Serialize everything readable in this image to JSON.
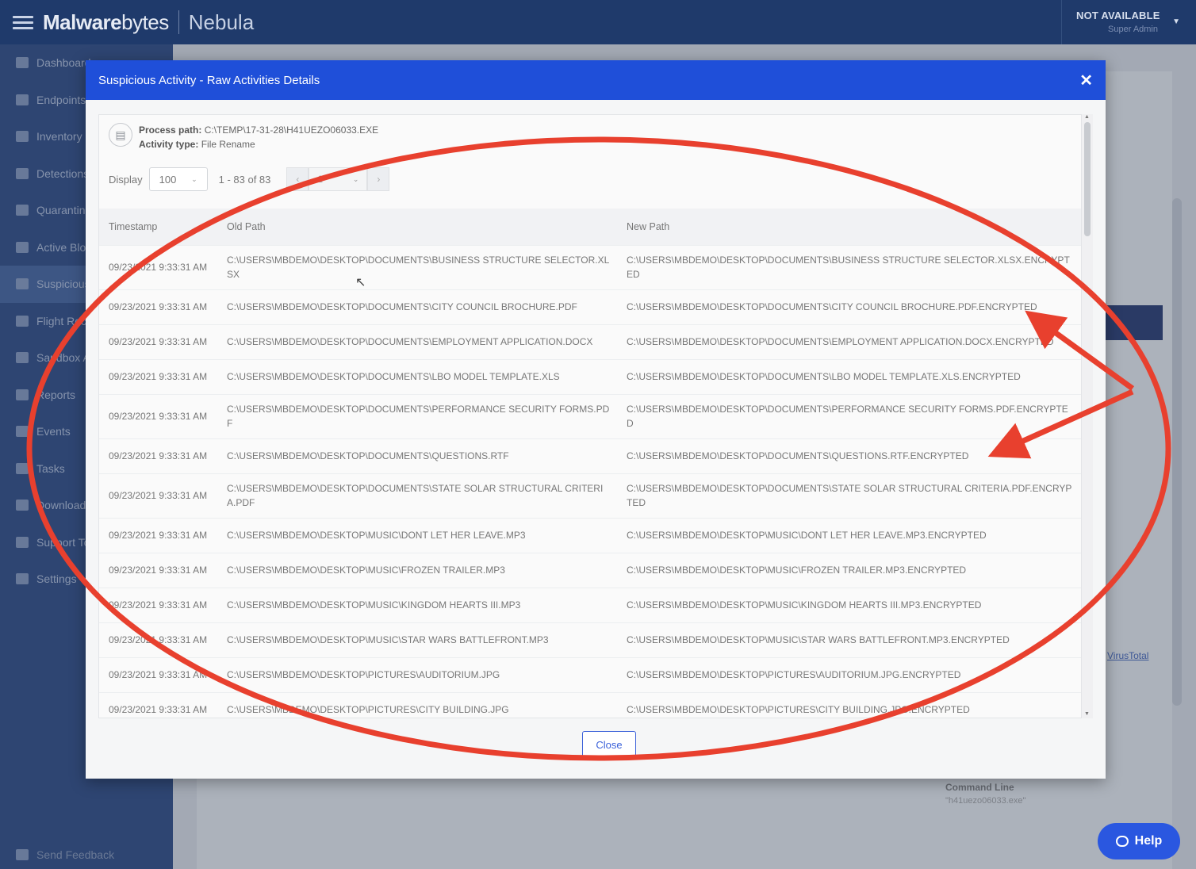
{
  "header": {
    "logo_bold": "Malware",
    "logo_light": "bytes",
    "product": "Nebula",
    "account_name": "NOT AVAILABLE",
    "account_role": "Super Admin"
  },
  "sidebar": {
    "items": [
      {
        "label": "Dashboard",
        "icon": "chart-icon"
      },
      {
        "label": "Endpoints",
        "icon": "monitor-icon"
      },
      {
        "label": "Inventory",
        "icon": "tag-icon"
      },
      {
        "label": "Detections",
        "icon": "bug-icon"
      },
      {
        "label": "Quarantine",
        "icon": "shield-icon"
      },
      {
        "label": "Active Blocks",
        "icon": "arrows-icon"
      },
      {
        "label": "Suspicious Activity",
        "icon": "user-icon"
      },
      {
        "label": "Flight Recorder",
        "icon": "plane-icon"
      },
      {
        "label": "Sandbox Analysis",
        "icon": "bug-icon"
      },
      {
        "label": "Reports",
        "icon": "document-icon"
      },
      {
        "label": "Events",
        "icon": "history-icon"
      },
      {
        "label": "Tasks",
        "icon": "list-icon"
      },
      {
        "label": "Downloads",
        "icon": "download-icon"
      },
      {
        "label": "Support Tools",
        "icon": "chat-icon"
      },
      {
        "label": "Settings",
        "icon": "wrench-icon"
      }
    ],
    "feedback": "Send Feedback"
  },
  "background": {
    "virustotal_link": "VirusTotal",
    "command_line_label": "Command Line",
    "command_line_value": "\"h41uezo06033.exe\""
  },
  "help_label": "Help",
  "modal": {
    "title": "Suspicious Activity - Raw Activities Details",
    "process_path_label": "Process path:",
    "process_path": "C:\\TEMP\\17-31-28\\H41UEZO06033.EXE",
    "activity_type_label": "Activity type:",
    "activity_type": "File Rename",
    "display_label": "Display",
    "display_value": "100",
    "range_text": "1 - 83 of 83",
    "current_page": "1",
    "columns": {
      "timestamp": "Timestamp",
      "old_path": "Old Path",
      "new_path": "New Path"
    },
    "rows": [
      {
        "ts": "09/23/2021 9:33:31 AM",
        "old": "C:\\USERS\\MBDEMO\\DESKTOP\\DOCUMENTS\\BUSINESS STRUCTURE SELECTOR.XLSX",
        "new": "C:\\USERS\\MBDEMO\\DESKTOP\\DOCUMENTS\\BUSINESS STRUCTURE SELECTOR.XLSX.ENCRYPTED"
      },
      {
        "ts": "09/23/2021 9:33:31 AM",
        "old": "C:\\USERS\\MBDEMO\\DESKTOP\\DOCUMENTS\\CITY COUNCIL BROCHURE.PDF",
        "new": "C:\\USERS\\MBDEMO\\DESKTOP\\DOCUMENTS\\CITY COUNCIL BROCHURE.PDF.ENCRYPTED"
      },
      {
        "ts": "09/23/2021 9:33:31 AM",
        "old": "C:\\USERS\\MBDEMO\\DESKTOP\\DOCUMENTS\\EMPLOYMENT APPLICATION.DOCX",
        "new": "C:\\USERS\\MBDEMO\\DESKTOP\\DOCUMENTS\\EMPLOYMENT APPLICATION.DOCX.ENCRYPTED"
      },
      {
        "ts": "09/23/2021 9:33:31 AM",
        "old": "C:\\USERS\\MBDEMO\\DESKTOP\\DOCUMENTS\\LBO MODEL TEMPLATE.XLS",
        "new": "C:\\USERS\\MBDEMO\\DESKTOP\\DOCUMENTS\\LBO MODEL TEMPLATE.XLS.ENCRYPTED"
      },
      {
        "ts": "09/23/2021 9:33:31 AM",
        "old": "C:\\USERS\\MBDEMO\\DESKTOP\\DOCUMENTS\\PERFORMANCE SECURITY FORMS.PDF",
        "new": "C:\\USERS\\MBDEMO\\DESKTOP\\DOCUMENTS\\PERFORMANCE SECURITY FORMS.PDF.ENCRYPTED"
      },
      {
        "ts": "09/23/2021 9:33:31 AM",
        "old": "C:\\USERS\\MBDEMO\\DESKTOP\\DOCUMENTS\\QUESTIONS.RTF",
        "new": "C:\\USERS\\MBDEMO\\DESKTOP\\DOCUMENTS\\QUESTIONS.RTF.ENCRYPTED"
      },
      {
        "ts": "09/23/2021 9:33:31 AM",
        "old": "C:\\USERS\\MBDEMO\\DESKTOP\\DOCUMENTS\\STATE SOLAR STRUCTURAL CRITERIA.PDF",
        "new": "C:\\USERS\\MBDEMO\\DESKTOP\\DOCUMENTS\\STATE SOLAR STRUCTURAL CRITERIA.PDF.ENCRYPTED"
      },
      {
        "ts": "09/23/2021 9:33:31 AM",
        "old": "C:\\USERS\\MBDEMO\\DESKTOP\\MUSIC\\DONT LET HER LEAVE.MP3",
        "new": "C:\\USERS\\MBDEMO\\DESKTOP\\MUSIC\\DONT LET HER LEAVE.MP3.ENCRYPTED"
      },
      {
        "ts": "09/23/2021 9:33:31 AM",
        "old": "C:\\USERS\\MBDEMO\\DESKTOP\\MUSIC\\FROZEN TRAILER.MP3",
        "new": "C:\\USERS\\MBDEMO\\DESKTOP\\MUSIC\\FROZEN TRAILER.MP3.ENCRYPTED"
      },
      {
        "ts": "09/23/2021 9:33:31 AM",
        "old": "C:\\USERS\\MBDEMO\\DESKTOP\\MUSIC\\KINGDOM HEARTS III.MP3",
        "new": "C:\\USERS\\MBDEMO\\DESKTOP\\MUSIC\\KINGDOM HEARTS III.MP3.ENCRYPTED"
      },
      {
        "ts": "09/23/2021 9:33:31 AM",
        "old": "C:\\USERS\\MBDEMO\\DESKTOP\\MUSIC\\STAR WARS BATTLEFRONT.MP3",
        "new": "C:\\USERS\\MBDEMO\\DESKTOP\\MUSIC\\STAR WARS BATTLEFRONT.MP3.ENCRYPTED"
      },
      {
        "ts": "09/23/2021 9:33:31 AM",
        "old": "C:\\USERS\\MBDEMO\\DESKTOP\\PICTURES\\AUDITORIUM.JPG",
        "new": "C:\\USERS\\MBDEMO\\DESKTOP\\PICTURES\\AUDITORIUM.JPG.ENCRYPTED"
      },
      {
        "ts": "09/23/2021 9:33:31 AM",
        "old": "C:\\USERS\\MBDEMO\\DESKTOP\\PICTURES\\CITY BUILDING.JPG",
        "new": "C:\\USERS\\MBDEMO\\DESKTOP\\PICTURES\\CITY BUILDING.JPG.ENCRYPTED"
      }
    ],
    "close_label": "Close"
  },
  "colors": {
    "topbar": "#1f3a6b",
    "sidebar": "#22407a",
    "modal_header": "#1f4fd9",
    "annotation_red": "#e8402e"
  }
}
